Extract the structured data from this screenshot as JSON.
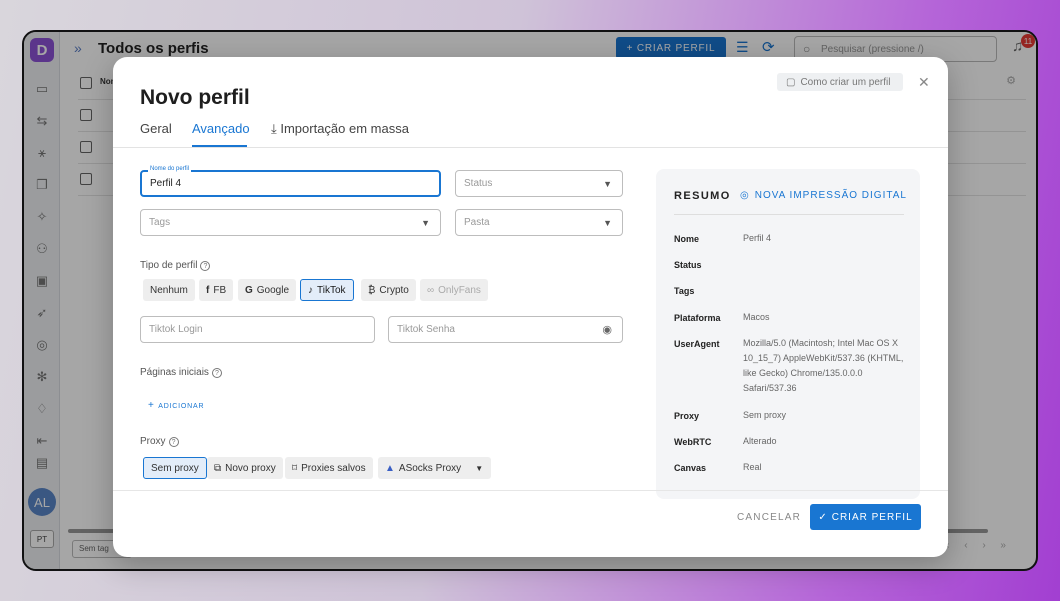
{
  "app": {
    "logo_letter": "D",
    "page_title": "Todos os perfis",
    "create_button": "+ CRIAR PERFIL",
    "search_placeholder": "Pesquisar (pressione /)",
    "notification_count": "11",
    "avatar_initials": "AL",
    "language": "PT",
    "table_column_name": "Nom",
    "tag_select": "Sem tag",
    "pager": "« ‹ › »"
  },
  "modal": {
    "title": "Novo perfil",
    "howto_link": "Como criar um perfil",
    "tabs": [
      {
        "label": "Geral"
      },
      {
        "label": "Avançado"
      },
      {
        "label": "Importação em massa"
      }
    ],
    "fields": {
      "profile_name_label": "Nome do perfil",
      "profile_name_value": "Perfil 4",
      "status_placeholder": "Status",
      "tags_placeholder": "Tags",
      "folder_placeholder": "Pasta",
      "login_placeholder": "Tiktok Login",
      "password_placeholder": "Tiktok Senha"
    },
    "profile_type_label": "Tipo de perfil",
    "profile_types": [
      {
        "label": "Nenhum",
        "icon": ""
      },
      {
        "label": "FB",
        "icon": "f"
      },
      {
        "label": "Google",
        "icon": "G"
      },
      {
        "label": "TikTok",
        "icon": "♪"
      },
      {
        "label": "Crypto",
        "icon": "₿"
      },
      {
        "label": "OnlyFans",
        "icon": "∞"
      }
    ],
    "start_pages_label": "Páginas iniciais",
    "add_button": "ADICIONAR",
    "proxy_label": "Proxy",
    "proxy_options": [
      {
        "label": "Sem proxy"
      },
      {
        "label": "Novo proxy"
      },
      {
        "label": "Proxies salvos"
      },
      {
        "label": "ASocks Proxy"
      }
    ],
    "cancel_button": "CANCELAR",
    "create_button": "CRIAR PERFIL"
  },
  "summary": {
    "title": "RESUMO",
    "fingerprint_button": "NOVA IMPRESSÃO DIGITAL",
    "rows": [
      {
        "key": "Nome",
        "value": "Perfil 4"
      },
      {
        "key": "Status",
        "value": ""
      },
      {
        "key": "Tags",
        "value": ""
      },
      {
        "key": "Plataforma",
        "value": "Macos"
      },
      {
        "key": "UserAgent",
        "value": "Mozilla/5.0 (Macintosh; Intel Mac OS X 10_15_7) AppleWebKit/537.36 (KHTML, like Gecko) Chrome/135.0.0.0 Safari/537.36"
      },
      {
        "key": "Proxy",
        "value": "Sem proxy"
      },
      {
        "key": "WebRTC",
        "value": "Alterado"
      },
      {
        "key": "Canvas",
        "value": "Real"
      }
    ]
  },
  "colors": {
    "accent": "#1976d2",
    "logo": "#8d52d6",
    "badge": "#e53935"
  }
}
